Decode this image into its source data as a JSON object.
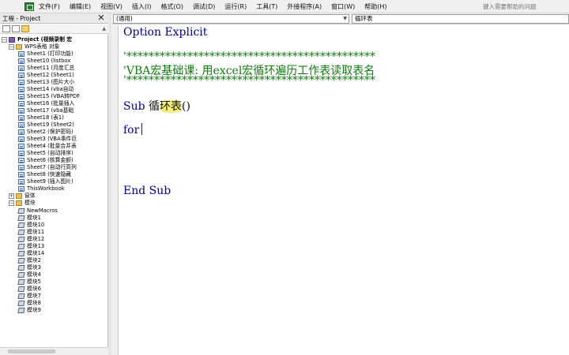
{
  "menubar": {
    "items": [
      "文件(F)",
      "编辑(E)",
      "视图(V)",
      "插入(I)",
      "格式(O)",
      "调试(D)",
      "运行(R)",
      "工具(T)",
      "外接程序(A)",
      "窗口(W)",
      "帮助(H)"
    ],
    "help_placeholder": "键入需要帮助的问题"
  },
  "project": {
    "title": "工程 - Project",
    "root": "Project (视频录制 宏",
    "objects_folder": "WPS表格 对象",
    "sheets": [
      "Sheet1 (打印功能)",
      "Sheet10 (listbox",
      "Sheet11 (月度汇总",
      "Sheet12 (Sheet1)",
      "Sheet13 (图片大小",
      "Sheet14 (vba自动",
      "Sheet15 (VBA转PDF",
      "Sheet16 (批量插入",
      "Sheet17 (vba基础",
      "Sheet18 (表1)",
      "Sheet19 (Sheet2)",
      "Sheet2 (保护密码)",
      "Sheet3 (VBA事件巨",
      "Sheet4 (批量合并表",
      "Sheet5 (自动排序)",
      "Sheet6 (核算金额)",
      "Sheet7 (自动行高列",
      "Sheet8 (快速隐藏",
      "Sheet9 (插入图片)",
      "ThisWorkbook"
    ],
    "forms_folder": "窗体",
    "modules_folder": "模块",
    "modules": [
      "NewMacros",
      "模块1",
      "模块10",
      "模块11",
      "模块12",
      "模块13",
      "模块14",
      "模块2",
      "模块3",
      "模块4",
      "模块5",
      "模块6",
      "模块7",
      "模块8",
      "模块9"
    ]
  },
  "code_window": {
    "object_combo": "(通用)",
    "procedure_combo": "循环表",
    "lines": {
      "option": "Option Explicit",
      "stars1": "'*********************************************",
      "comment": "'VBA宏基础课: 用excel宏循环遍历工作表读取表名",
      "stars2": "'*********************************************",
      "sub_kw": "Sub",
      "sub_name_a": "循",
      "sub_name_b": "环表",
      "sub_parens": "()",
      "for_kw": "for",
      "end_sub": "End Sub"
    }
  }
}
